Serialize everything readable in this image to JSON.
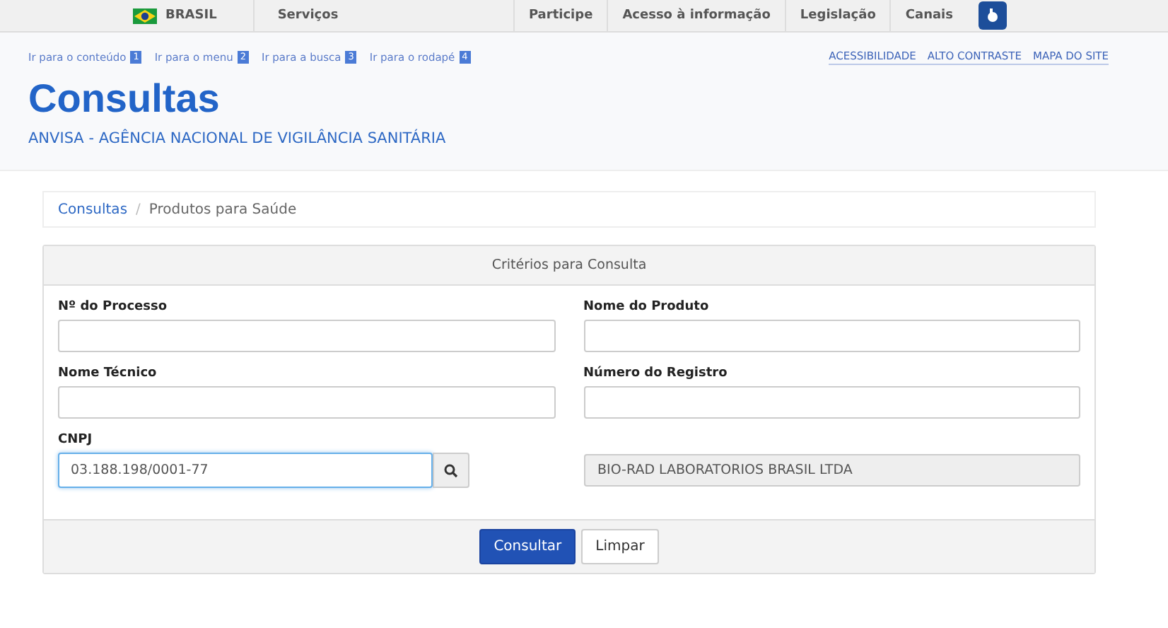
{
  "top_bar": {
    "country": "BRASIL",
    "left_links": [
      "Serviços"
    ],
    "right_links": [
      "Participe",
      "Acesso à informação",
      "Legislação",
      "Canais"
    ]
  },
  "skip_links": [
    {
      "label": "Ir para o conteúdo",
      "key": "1"
    },
    {
      "label": "Ir para o menu",
      "key": "2"
    },
    {
      "label": "Ir para a busca",
      "key": "3"
    },
    {
      "label": "Ir para o rodapé",
      "key": "4"
    }
  ],
  "accessibility_links": [
    "ACESSIBILIDADE",
    "ALTO CONTRASTE",
    "MAPA DO SITE"
  ],
  "header": {
    "title": "Consultas",
    "subtitle": "ANVISA - AGÊNCIA NACIONAL DE VIGILÂNCIA SANITÁRIA"
  },
  "breadcrumb": {
    "separator": "/",
    "items": [
      {
        "label": "Consultas",
        "link": true
      },
      {
        "label": "Produtos para Saúde",
        "link": false
      }
    ]
  },
  "form": {
    "heading": "Critérios para Consulta",
    "fields": [
      {
        "label": "Nº do Processo"
      },
      {
        "label": "Nome do Produto"
      },
      {
        "label": "Nome Técnico"
      },
      {
        "label": "Número do Registro"
      }
    ],
    "cnpj": {
      "label": "CNPJ",
      "value": "03.188.198/0001-77",
      "company": "BIO-RAD LABORATORIOS BRASIL LTDA"
    },
    "buttons": [
      {
        "label": "Consultar",
        "kind": "primary"
      },
      {
        "label": "Limpar",
        "kind": "default"
      }
    ]
  }
}
